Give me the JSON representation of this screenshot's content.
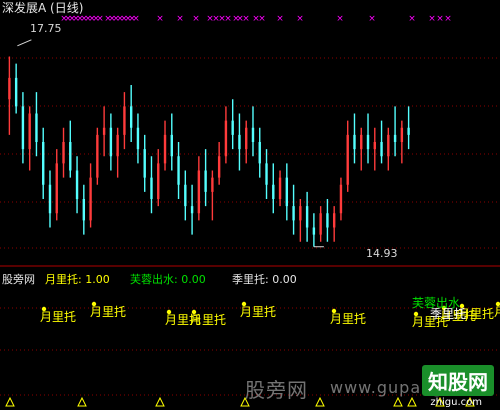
{
  "chart_title": "深发展A (日线)",
  "price_labels": {
    "high": "17.75",
    "low": "14.93"
  },
  "indicator_bar": {
    "items": [
      {
        "label": "股旁网",
        "color": "#e6e6e6"
      },
      {
        "label": "月里托: 1.00",
        "color": "#ffff00"
      },
      {
        "label": "芙蓉出水: 0.00",
        "color": "#00e000"
      },
      {
        "label": "季里托: 0.00",
        "color": "#e6e6e6"
      }
    ]
  },
  "watermark": {
    "site_cn": "股旁网",
    "site_url": "www.gupang.com",
    "logo": "知股网",
    "logo_url": "zhigu.com"
  },
  "signal_text": {
    "monthly": "月里托",
    "lotus": "芙蓉出水",
    "highlight": "季里托"
  },
  "colors": {
    "up": "#ff3b3b",
    "down": "#54ffff",
    "grid": "#8b0000",
    "cross": "#ff00ff",
    "yellow": "#ffff00",
    "green": "#00e000"
  },
  "chart_data": {
    "type": "candlestick",
    "series": [
      {
        "name": "深发展A",
        "ohlc": [
          [
            17.0,
            17.6,
            16.5,
            17.3
          ],
          [
            17.3,
            17.5,
            16.8,
            16.9
          ],
          [
            16.9,
            17.1,
            16.1,
            16.3
          ],
          [
            16.3,
            16.9,
            16.0,
            16.8
          ],
          [
            16.8,
            17.1,
            16.2,
            16.4
          ],
          [
            16.4,
            16.6,
            15.6,
            15.8
          ],
          [
            15.8,
            16.0,
            15.2,
            15.4
          ],
          [
            15.4,
            16.3,
            15.3,
            16.1
          ],
          [
            16.1,
            16.6,
            15.9,
            16.4
          ],
          [
            16.4,
            16.7,
            15.9,
            16.0
          ],
          [
            16.0,
            16.2,
            15.4,
            15.6
          ],
          [
            15.6,
            15.8,
            15.1,
            15.3
          ],
          [
            15.3,
            16.1,
            15.2,
            15.9
          ],
          [
            15.9,
            16.6,
            15.8,
            16.5
          ],
          [
            16.5,
            16.9,
            16.2,
            16.6
          ],
          [
            16.6,
            16.8,
            16.0,
            16.2
          ],
          [
            16.2,
            16.6,
            15.9,
            16.5
          ],
          [
            16.5,
            17.1,
            16.3,
            16.9
          ],
          [
            16.9,
            17.2,
            16.4,
            16.6
          ],
          [
            16.6,
            16.8,
            16.1,
            16.3
          ],
          [
            16.3,
            16.5,
            15.7,
            15.9
          ],
          [
            15.9,
            16.2,
            15.4,
            15.6
          ],
          [
            15.6,
            16.3,
            15.5,
            16.1
          ],
          [
            16.1,
            16.7,
            16.0,
            16.5
          ],
          [
            16.5,
            16.8,
            16.0,
            16.2
          ],
          [
            16.2,
            16.4,
            15.6,
            15.8
          ],
          [
            15.8,
            16.0,
            15.3,
            15.5
          ],
          [
            15.5,
            15.8,
            15.1,
            15.4
          ],
          [
            15.4,
            16.2,
            15.3,
            16.0
          ],
          [
            16.0,
            16.3,
            15.5,
            15.7
          ],
          [
            15.7,
            16.0,
            15.3,
            15.9
          ],
          [
            15.9,
            16.4,
            15.8,
            16.2
          ],
          [
            16.2,
            16.9,
            16.1,
            16.7
          ],
          [
            16.7,
            17.0,
            16.3,
            16.5
          ],
          [
            16.5,
            16.8,
            16.0,
            16.3
          ],
          [
            16.3,
            16.7,
            16.1,
            16.6
          ],
          [
            16.6,
            16.9,
            16.2,
            16.4
          ],
          [
            16.4,
            16.6,
            15.9,
            16.1
          ],
          [
            16.1,
            16.3,
            15.6,
            15.8
          ],
          [
            15.8,
            16.1,
            15.4,
            15.6
          ],
          [
            15.6,
            16.0,
            15.5,
            15.9
          ],
          [
            15.9,
            16.1,
            15.3,
            15.5
          ],
          [
            15.5,
            15.8,
            15.1,
            15.3
          ],
          [
            15.3,
            15.6,
            15.0,
            15.5
          ],
          [
            15.5,
            15.7,
            15.0,
            15.2
          ],
          [
            15.2,
            15.4,
            14.93,
            15.1
          ],
          [
            15.1,
            15.5,
            15.0,
            15.4
          ],
          [
            15.4,
            15.6,
            15.0,
            15.2
          ],
          [
            15.2,
            15.5,
            15.0,
            15.4
          ],
          [
            15.4,
            15.9,
            15.3,
            15.8
          ],
          [
            15.8,
            16.7,
            15.7,
            16.5
          ],
          [
            16.5,
            16.8,
            16.1,
            16.3
          ],
          [
            16.3,
            16.6,
            16.0,
            16.5
          ],
          [
            16.5,
            16.8,
            16.1,
            16.3
          ],
          [
            16.3,
            16.6,
            16.0,
            16.4
          ],
          [
            16.4,
            16.7,
            16.1,
            16.2
          ],
          [
            16.2,
            16.6,
            16.0,
            16.5
          ],
          [
            16.5,
            16.9,
            16.2,
            16.4
          ],
          [
            16.4,
            16.7,
            16.1,
            16.6
          ],
          [
            16.6,
            16.9,
            16.3,
            16.5
          ]
        ]
      }
    ],
    "ylim": [
      14.8,
      18.0
    ],
    "annotations": [
      {
        "text": "17.75",
        "value": 17.75
      },
      {
        "text": "14.93",
        "value": 14.93
      }
    ],
    "indicator_values": {
      "月里托": 1.0,
      "芙蓉出水": 0.0,
      "季里托": 0.0
    }
  }
}
